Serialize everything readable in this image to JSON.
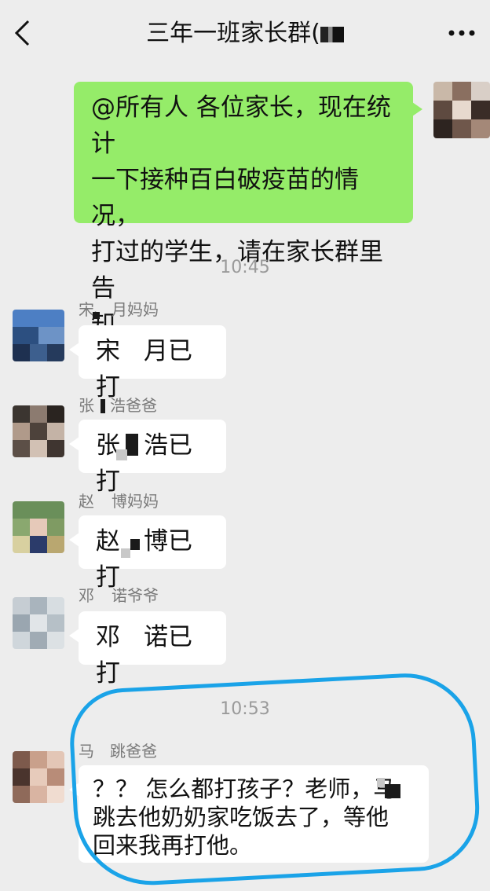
{
  "header": {
    "title": "三年一班家长群(",
    "back_icon": "chevron-left-icon",
    "more_icon": "more-horizontal-icon"
  },
  "messages": {
    "teacher": {
      "line1": "@所有人 各位家长，现在统计",
      "line2": "一下接种百白破疫苗的情况，",
      "line3": "打过的学生，请在家长群里告",
      "line4": "知。"
    },
    "time1": "10:45",
    "m1": {
      "sender_a": "宋",
      "sender_b": "月妈妈",
      "text_a": "宋",
      "text_b": "月已打"
    },
    "m2": {
      "sender_a": "张",
      "sender_b": "浩爸爸",
      "text_a": "张",
      "text_b": "浩已打"
    },
    "m3": {
      "sender_a": "赵",
      "sender_b": "博妈妈",
      "text_a": "赵",
      "text_b": "博已打"
    },
    "m4": {
      "sender_a": "邓",
      "sender_b": "诺爷爷",
      "text_a": "邓",
      "text_b": "诺已打"
    },
    "time2": "10:53",
    "m5": {
      "sender_a": "马",
      "sender_b": "跳爸爸",
      "line1": "？？ 怎么都打孩子？老师，马",
      "line2": "跳去他奶奶家吃饭去了，等他",
      "line3": "回来我再打他。"
    }
  },
  "colors": {
    "background": "#ededed",
    "own_bubble": "#95ec69",
    "other_bubble": "#ffffff",
    "highlight_circle": "#1aa3e8"
  }
}
